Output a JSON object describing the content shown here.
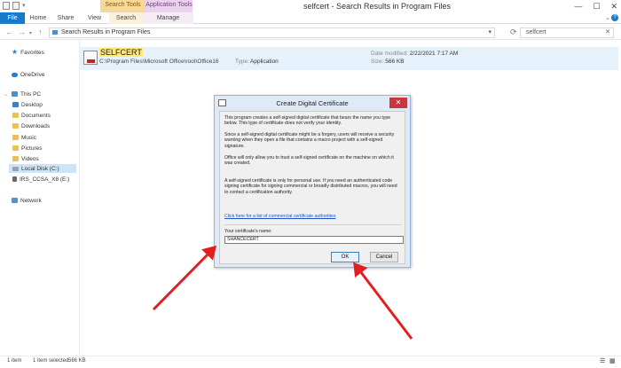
{
  "window": {
    "title": "selfcert - Search Results in Program Files",
    "context_search": "Search Tools",
    "context_app": "Application Tools",
    "controls": [
      "—",
      "☐",
      "✕"
    ]
  },
  "ribbon": {
    "tabs": [
      "File",
      "Home",
      "Share",
      "View",
      "Search",
      "Manage"
    ]
  },
  "address": {
    "path": "Search Results in Program Files",
    "search_value": "selfcert"
  },
  "sidebar": {
    "items": [
      {
        "label": "Favorites"
      },
      {
        "label": "OneDrive"
      },
      {
        "label": "This PC"
      },
      {
        "label": "Desktop"
      },
      {
        "label": "Documents"
      },
      {
        "label": "Downloads"
      },
      {
        "label": "Music"
      },
      {
        "label": "Pictures"
      },
      {
        "label": "Videos"
      },
      {
        "label": "Local Disk (C:)"
      },
      {
        "label": "IRS_CCSA_X8 (E:)"
      },
      {
        "label": "Network"
      }
    ]
  },
  "result": {
    "name": "SELFCERT",
    "path": "C:\\Program Files\\Microsoft Office\\root\\Office16",
    "type_label": "Type:",
    "type_value": "Application",
    "date_label": "Date modified:",
    "date_value": "2/22/2021 7:17 AM",
    "size_label": "Size:",
    "size_value": "566 KB"
  },
  "dialog": {
    "title": "Create Digital Certificate",
    "close": "✕",
    "para1": "This program creates a self-signed digital certificate that bears the name you type below. This type of certificate does not verify your identity.",
    "para2": "Since a self-signed digital certificate might be a forgery, users will receive a security warning when they open a file that contains a macro project with a self-signed signature.",
    "para3": "Office will only allow you to trust a self-signed certificate on the machine on which it was created.",
    "para4": "A self-signed certificate is only for personal use. If you need an authenticated code signing certificate for signing commercial or broadly distributed macros, you will need to contact a certification authority.",
    "link": "Click here for a list of commercial certificate authorities",
    "name_label": "Your certificate's name:",
    "name_value": "SHANCECERT",
    "ok": "OK",
    "cancel": "Cancel"
  },
  "status": {
    "count": "1 item",
    "selected": "1 item selected",
    "size": "566 KB"
  },
  "colors": {
    "file_tab": "#1979ca",
    "selection": "#e5f1fb",
    "annotation_arrow": "#e02020"
  }
}
